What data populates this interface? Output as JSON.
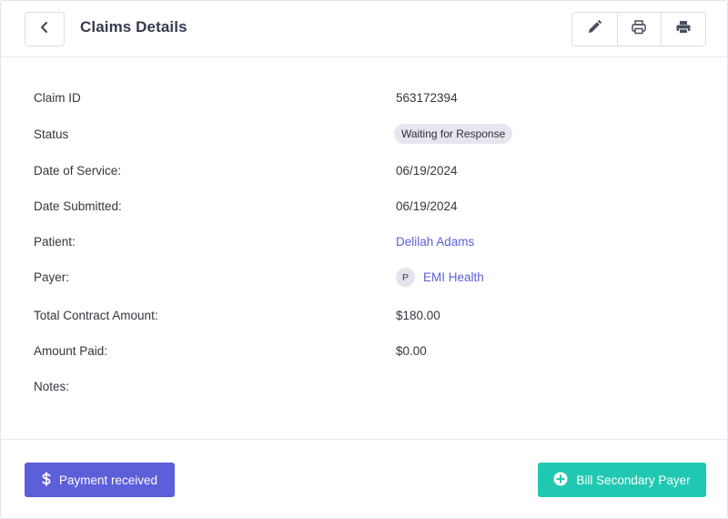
{
  "header": {
    "title": "Claims Details",
    "back_icon": "chevron-left-icon",
    "tools": [
      {
        "icon": "pencil-icon"
      },
      {
        "icon": "printer-outline-icon"
      },
      {
        "icon": "printer-filled-icon"
      }
    ]
  },
  "claim": {
    "claim_id_label": "Claim ID",
    "claim_id": "563172394",
    "status_label": "Status",
    "status": "Waiting for Response",
    "date_of_service_label": "Date of Service:",
    "date_of_service": "06/19/2024",
    "date_submitted_label": "Date Submitted:",
    "date_submitted": "06/19/2024",
    "patient_label": "Patient:",
    "patient": "Delilah Adams",
    "payer_label": "Payer:",
    "payer_initial": "P",
    "payer": "EMI Health",
    "total_contract_label": "Total Contract Amount:",
    "total_contract": "$180.00",
    "amount_paid_label": "Amount Paid:",
    "amount_paid": "$0.00",
    "notes_label": "Notes:",
    "notes": ""
  },
  "footer": {
    "payment_received_label": "Payment received",
    "payment_icon": "dollar-icon",
    "bill_secondary_label": "Bill Secondary Payer",
    "bill_icon": "plus-circle-icon"
  },
  "colors": {
    "primary": "#5b5fd8",
    "secondary": "#21c8b1",
    "link": "#5a5fd6"
  }
}
